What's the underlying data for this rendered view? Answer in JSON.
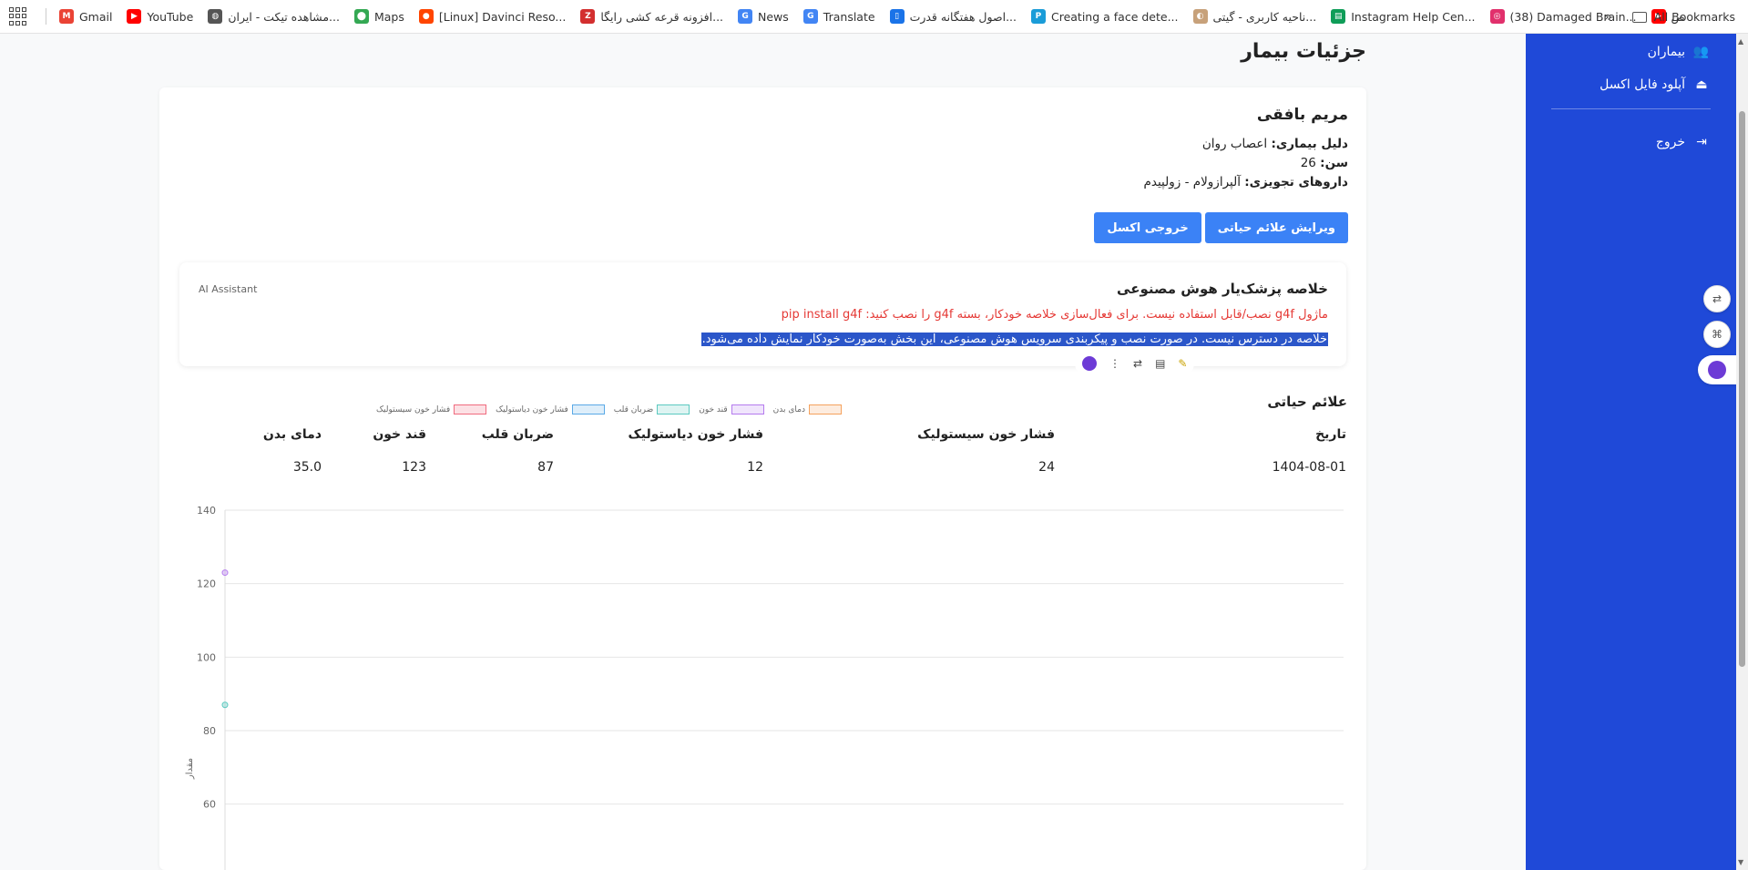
{
  "bookmarks": {
    "items": [
      {
        "label": "Gmail",
        "icon": "gmail-icon",
        "color": "#ea4335",
        "glyph": "M"
      },
      {
        "label": "YouTube",
        "icon": "youtube-icon",
        "color": "#ff0000",
        "glyph": "▶"
      },
      {
        "label": "مشاهده تیکت - ایران...",
        "icon": "globe-icon",
        "color": "#555555",
        "glyph": "◍"
      },
      {
        "label": "Maps",
        "icon": "maps-icon",
        "color": "#34a853",
        "glyph": "⬤"
      },
      {
        "label": "[Linux] Davinci Reso...",
        "icon": "reddit-icon",
        "color": "#ff4500",
        "glyph": "●"
      },
      {
        "label": "افزونه قرعه کشی رایگا...",
        "icon": "bookmark-red-icon",
        "color": "#d32f2f",
        "glyph": "Z"
      },
      {
        "label": "News",
        "icon": "news-icon",
        "color": "#4285f4",
        "glyph": "G"
      },
      {
        "label": "Translate",
        "icon": "translate-icon",
        "color": "#4285f4",
        "glyph": "G"
      },
      {
        "label": "اصول هفتگانه قدرت...",
        "icon": "doc-icon",
        "color": "#1a73e8",
        "glyph": "▯"
      },
      {
        "label": "Creating a face dete...",
        "icon": "pulse-icon",
        "color": "#1a9cd8",
        "glyph": "P"
      },
      {
        "label": "ناحیه کاربری - گیتی...",
        "icon": "site-icon",
        "color": "#c7a17a",
        "glyph": "◐"
      },
      {
        "label": "Instagram Help Cen...",
        "icon": "instagram-icon",
        "color": "#0f9d58",
        "glyph": "▤"
      },
      {
        "label": "(38) Damaged Brain...",
        "icon": "instagram-icon",
        "color": "#e1306c",
        "glyph": "◎"
      },
      {
        "label": "ص",
        "icon": "youtube-icon",
        "color": "#ff0000",
        "glyph": "▶"
      }
    ],
    "more": "»",
    "all_bookmarks": "All Bookmarks",
    "extra_icon_color": "#ff6a00"
  },
  "sidebar": {
    "items": [
      {
        "label": "بیماران",
        "icon": "users-icon",
        "glyph": "👥"
      },
      {
        "label": "آپلود فایل اکسل",
        "icon": "upload-icon",
        "glyph": "⏏"
      }
    ],
    "logout": {
      "label": "خروج",
      "icon": "logout-icon",
      "glyph": "⇥"
    },
    "color": "#1f49d8"
  },
  "page_title": "جزئیات بیمار",
  "patient": {
    "name": "مریم بافقی",
    "reason_label": "دلیل بیماری:",
    "reason": "اعصاب روان",
    "age_label": "سن:",
    "age": "26",
    "drugs_label": "داروهای تجویزی:",
    "drugs": "آلپرازولام - زولپیدم"
  },
  "buttons": {
    "edit_vitals": "ویرایش علائم حیاتی",
    "export_excel": "خروجی اکسل"
  },
  "ai_summary": {
    "title": "خلاصه پزشک‌یار هوش مصنوعی",
    "tag": "AI Assistant",
    "warning": "ماژول g4f نصب/قابل استفاده نیست. برای فعال‌سازی خلاصه خودکار، بسته g4f را نصب کنید: pip install g4f",
    "message": "خلاصه در دسترس نیست. در صورت نصب و پیکربندی سرویس هوش مصنوعی، این بخش به‌صورت خودکار نمایش داده می‌شود."
  },
  "vitals": {
    "title": "علائم حیاتی",
    "headers": [
      "تاریخ",
      "فشار خون سیستولیک",
      "فشار خون دیاستولیک",
      "ضربان قلب",
      "قند خون",
      "دمای بدن"
    ],
    "rows": [
      [
        "1404-08-01",
        "24",
        "12",
        "87",
        "123",
        "35.0"
      ]
    ]
  },
  "chart_data": {
    "type": "line",
    "categories": [
      "1404-08-01"
    ],
    "series": [
      {
        "name": "دمای بدن",
        "values": [
          35.0
        ],
        "color": "#f5a25d"
      },
      {
        "name": "قند خون",
        "values": [
          123
        ],
        "color": "#b57bee"
      },
      {
        "name": "ضربان قلب",
        "values": [
          87
        ],
        "color": "#5cc9c0"
      },
      {
        "name": "فشار خون دیاستولیک",
        "values": [
          12
        ],
        "color": "#5aa9e6"
      },
      {
        "name": "فشار خون سیستولیک",
        "values": [
          24
        ],
        "color": "#f06b7f"
      }
    ],
    "yticks": [
      60,
      80,
      100,
      120,
      140
    ],
    "ylim": [
      55,
      140
    ],
    "ylabel": "مقدار",
    "grid": true,
    "legend": "top-center"
  }
}
